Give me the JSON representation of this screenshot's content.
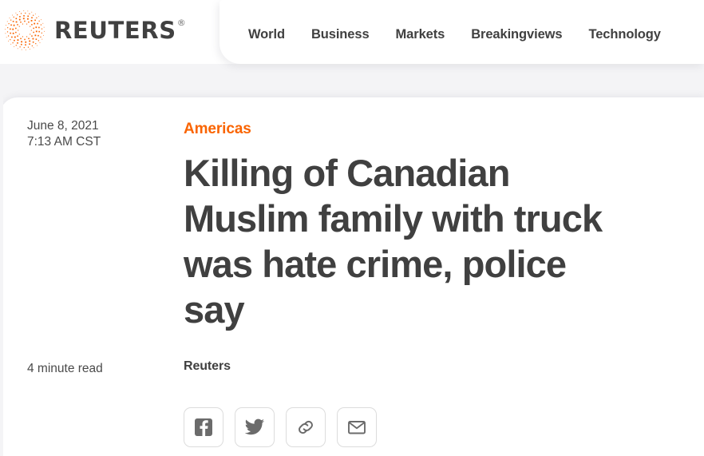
{
  "site": {
    "brand_name": "REUTERS",
    "registered_mark": "®",
    "logo_icon": "reuters-dot-spiral-logo",
    "brand_color": "#fa6400",
    "text_color": "#404040"
  },
  "nav": {
    "items": [
      {
        "label": "World"
      },
      {
        "label": "Business"
      },
      {
        "label": "Markets"
      },
      {
        "label": "Breakingviews"
      },
      {
        "label": "Technology"
      }
    ]
  },
  "article": {
    "date": "June 8, 2021",
    "time": "7:13 AM CST",
    "read_time": "4 minute read",
    "kicker": "Americas",
    "headline": "Killing of Canadian Muslim family with truck was hate crime, police say",
    "byline": "Reuters"
  },
  "share": {
    "buttons": [
      {
        "name": "facebook",
        "icon": "facebook-icon",
        "label": "Share on Facebook"
      },
      {
        "name": "twitter",
        "icon": "twitter-icon",
        "label": "Share on Twitter"
      },
      {
        "name": "link",
        "icon": "link-icon",
        "label": "Copy link"
      },
      {
        "name": "email",
        "icon": "email-icon",
        "label": "Share by email"
      }
    ]
  }
}
